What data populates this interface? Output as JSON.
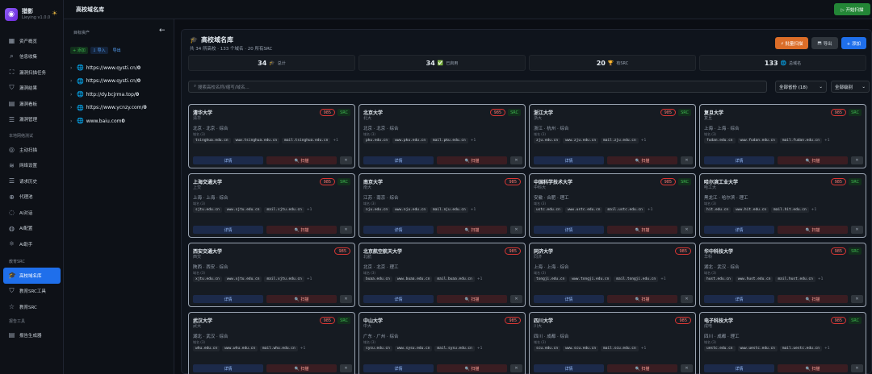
{
  "app": {
    "name": "猎影",
    "version": "Lieying v1.0.0"
  },
  "nav": [
    {
      "icon": "▦",
      "label": "资产概览",
      "active": false
    },
    {
      "icon": "⌕",
      "label": "信息收集",
      "active": false
    },
    {
      "icon": "⛶",
      "label": "漏洞扫描任务",
      "active": false
    },
    {
      "icon": "⛉",
      "label": "漏洞结果",
      "active": false
    },
    {
      "icon": "▤",
      "label": "漏洞看板",
      "active": false
    },
    {
      "icon": "☰",
      "label": "漏洞管理",
      "active": false
    }
  ],
  "section_scan": "本地网络测试",
  "nav_scan": [
    {
      "icon": "◎",
      "label": "主动扫描"
    },
    {
      "icon": "≋",
      "label": "网络设置"
    },
    {
      "icon": "☰",
      "label": "请求历史"
    },
    {
      "icon": "⊕",
      "label": "代理池"
    },
    {
      "icon": "◌",
      "label": "AI对话"
    },
    {
      "icon": "◍",
      "label": "AI配置"
    },
    {
      "icon": "⚛",
      "label": "AI助手"
    }
  ],
  "section_src": "教育SRC",
  "nav_src": [
    {
      "icon": "🎓",
      "label": "高校域名库",
      "active": true
    },
    {
      "icon": "⛉",
      "label": "教育SRC工具",
      "active": false
    },
    {
      "icon": "☆",
      "label": "教育SRC",
      "active": false
    }
  ],
  "section_report": "报告工具",
  "nav_report": [
    {
      "icon": "▤",
      "label": "报告生成器"
    }
  ],
  "topbar": {
    "title": "高校域名库",
    "scan_button": "▷ 开始扫描"
  },
  "targets": {
    "header": "目标资产",
    "add": "+ 添加",
    "import": "导入",
    "export": "导出",
    "items": [
      {
        "url": "https://www.qysti.cn/",
        "count": "0"
      },
      {
        "url": "https://www.qysti.cn/",
        "count": "0"
      },
      {
        "url": "http://dy.bcjrma.top/",
        "count": "0"
      },
      {
        "url": "https://www.ycnzy.com/",
        "count": "0"
      },
      {
        "url": "www.baiu.com",
        "count": "0"
      }
    ]
  },
  "main": {
    "title": "高校域名库",
    "subtitle": "共 34 所高校 · 133 个域名 · 20 所有SRC",
    "batch_button": "⚡ 批量扫描",
    "export_button": "导出",
    "add_button": "+ 添加",
    "stats": [
      {
        "num": "34",
        "label": "总计",
        "icon": "🎓"
      },
      {
        "num": "34",
        "label": "已启用",
        "icon": "✅"
      },
      {
        "num": "20",
        "label": "有SRC",
        "icon": "🏆"
      },
      {
        "num": "133",
        "label": "总域名",
        "icon": "🌐"
      }
    ],
    "search_placeholder": "搜索高校名称/缩写/域名...",
    "province_select": "全部省份 (18)",
    "level_select": "全部级别"
  },
  "card_labels": {
    "domain_label": "域名 (3)",
    "detail": "详情",
    "scan": "🔍 扫描",
    "delete": "✕",
    "more": "+1"
  },
  "universities": [
    {
      "name": "清华大学",
      "abbr": "清华",
      "tag": "985",
      "src": "SRC",
      "location": "北京 · 北京 · 综合",
      "domains": [
        "tsinghua.edu.cn",
        "www.tsinghua.edu.cn",
        "mail.tsinghua.edu.cn"
      ]
    },
    {
      "name": "北京大学",
      "abbr": "北大",
      "tag": "985",
      "src": "SRC",
      "location": "北京 · 北京 · 综合",
      "domains": [
        "pku.edu.cn",
        "www.pku.edu.cn",
        "mail.pku.edu.cn"
      ]
    },
    {
      "name": "浙江大学",
      "abbr": "浙大",
      "tag": "985",
      "src": "SRC",
      "location": "浙江 · 杭州 · 综合",
      "domains": [
        "zju.edu.cn",
        "www.zju.edu.cn",
        "mail.zju.edu.cn"
      ]
    },
    {
      "name": "复旦大学",
      "abbr": "复旦",
      "tag": "985",
      "src": "SRC",
      "location": "上海 · 上海 · 综合",
      "domains": [
        "fudan.edu.cn",
        "www.fudan.edu.cn",
        "mail.fudan.edu.cn"
      ]
    },
    {
      "name": "上海交通大学",
      "abbr": "上交",
      "tag": "985",
      "src": "SRC",
      "location": "上海 · 上海 · 综合",
      "domains": [
        "sjtu.edu.cn",
        "www.sjtu.edu.cn",
        "mail.sjtu.edu.cn"
      ]
    },
    {
      "name": "南京大学",
      "abbr": "南大",
      "tag": "985",
      "src": "",
      "location": "江苏 · 南京 · 综合",
      "domains": [
        "nju.edu.cn",
        "www.nju.edu.cn",
        "mail.nju.edu.cn"
      ]
    },
    {
      "name": "中国科学技术大学",
      "abbr": "中科大",
      "tag": "985",
      "src": "SRC",
      "location": "安徽 · 合肥 · 理工",
      "domains": [
        "ustc.edu.cn",
        "www.ustc.edu.cn",
        "mail.ustc.edu.cn"
      ]
    },
    {
      "name": "哈尔滨工业大学",
      "abbr": "哈工大",
      "tag": "985",
      "src": "SRC",
      "location": "黑龙江 · 哈尔滨 · 理工",
      "domains": [
        "hit.edu.cn",
        "www.hit.edu.cn",
        "mail.hit.edu.cn"
      ]
    },
    {
      "name": "西安交通大学",
      "abbr": "西交",
      "tag": "985",
      "src": "",
      "location": "陕西 · 西安 · 综合",
      "domains": [
        "xjtu.edu.cn",
        "www.xjtu.edu.cn",
        "mail.xjtu.edu.cn"
      ]
    },
    {
      "name": "北京航空航天大学",
      "abbr": "北航",
      "tag": "985",
      "src": "",
      "location": "北京 · 北京 · 理工",
      "domains": [
        "buaa.edu.cn",
        "www.buaa.edu.cn",
        "mail.buaa.edu.cn"
      ]
    },
    {
      "name": "同济大学",
      "abbr": "同济",
      "tag": "985",
      "src": "",
      "location": "上海 · 上海 · 综合",
      "domains": [
        "tongji.edu.cn",
        "www.tongji.edu.cn",
        "mail.tongji.edu.cn"
      ]
    },
    {
      "name": "华中科技大学",
      "abbr": "华科",
      "tag": "985",
      "src": "SRC",
      "location": "湖北 · 武汉 · 综合",
      "domains": [
        "hust.edu.cn",
        "www.hust.edu.cn",
        "mail.hust.edu.cn"
      ]
    },
    {
      "name": "武汉大学",
      "abbr": "武大",
      "tag": "985",
      "src": "SRC",
      "location": "湖北 · 武汉 · 综合",
      "domains": [
        "whu.edu.cn",
        "www.whu.edu.cn",
        "mail.whu.edu.cn"
      ]
    },
    {
      "name": "中山大学",
      "abbr": "中大",
      "tag": "985",
      "src": "",
      "location": "广东 · 广州 · 综合",
      "domains": [
        "sysu.edu.cn",
        "www.sysu.edu.cn",
        "mail.sysu.edu.cn"
      ]
    },
    {
      "name": "四川大学",
      "abbr": "川大",
      "tag": "985",
      "src": "",
      "location": "四川 · 成都 · 综合",
      "domains": [
        "scu.edu.cn",
        "www.scu.edu.cn",
        "mail.scu.edu.cn"
      ]
    },
    {
      "name": "电子科技大学",
      "abbr": "成电",
      "tag": "985",
      "src": "SRC",
      "location": "四川 · 成都 · 理工",
      "domains": [
        "uestc.edu.cn",
        "www.uestc.edu.cn",
        "mail.uestc.edu.cn"
      ]
    }
  ]
}
